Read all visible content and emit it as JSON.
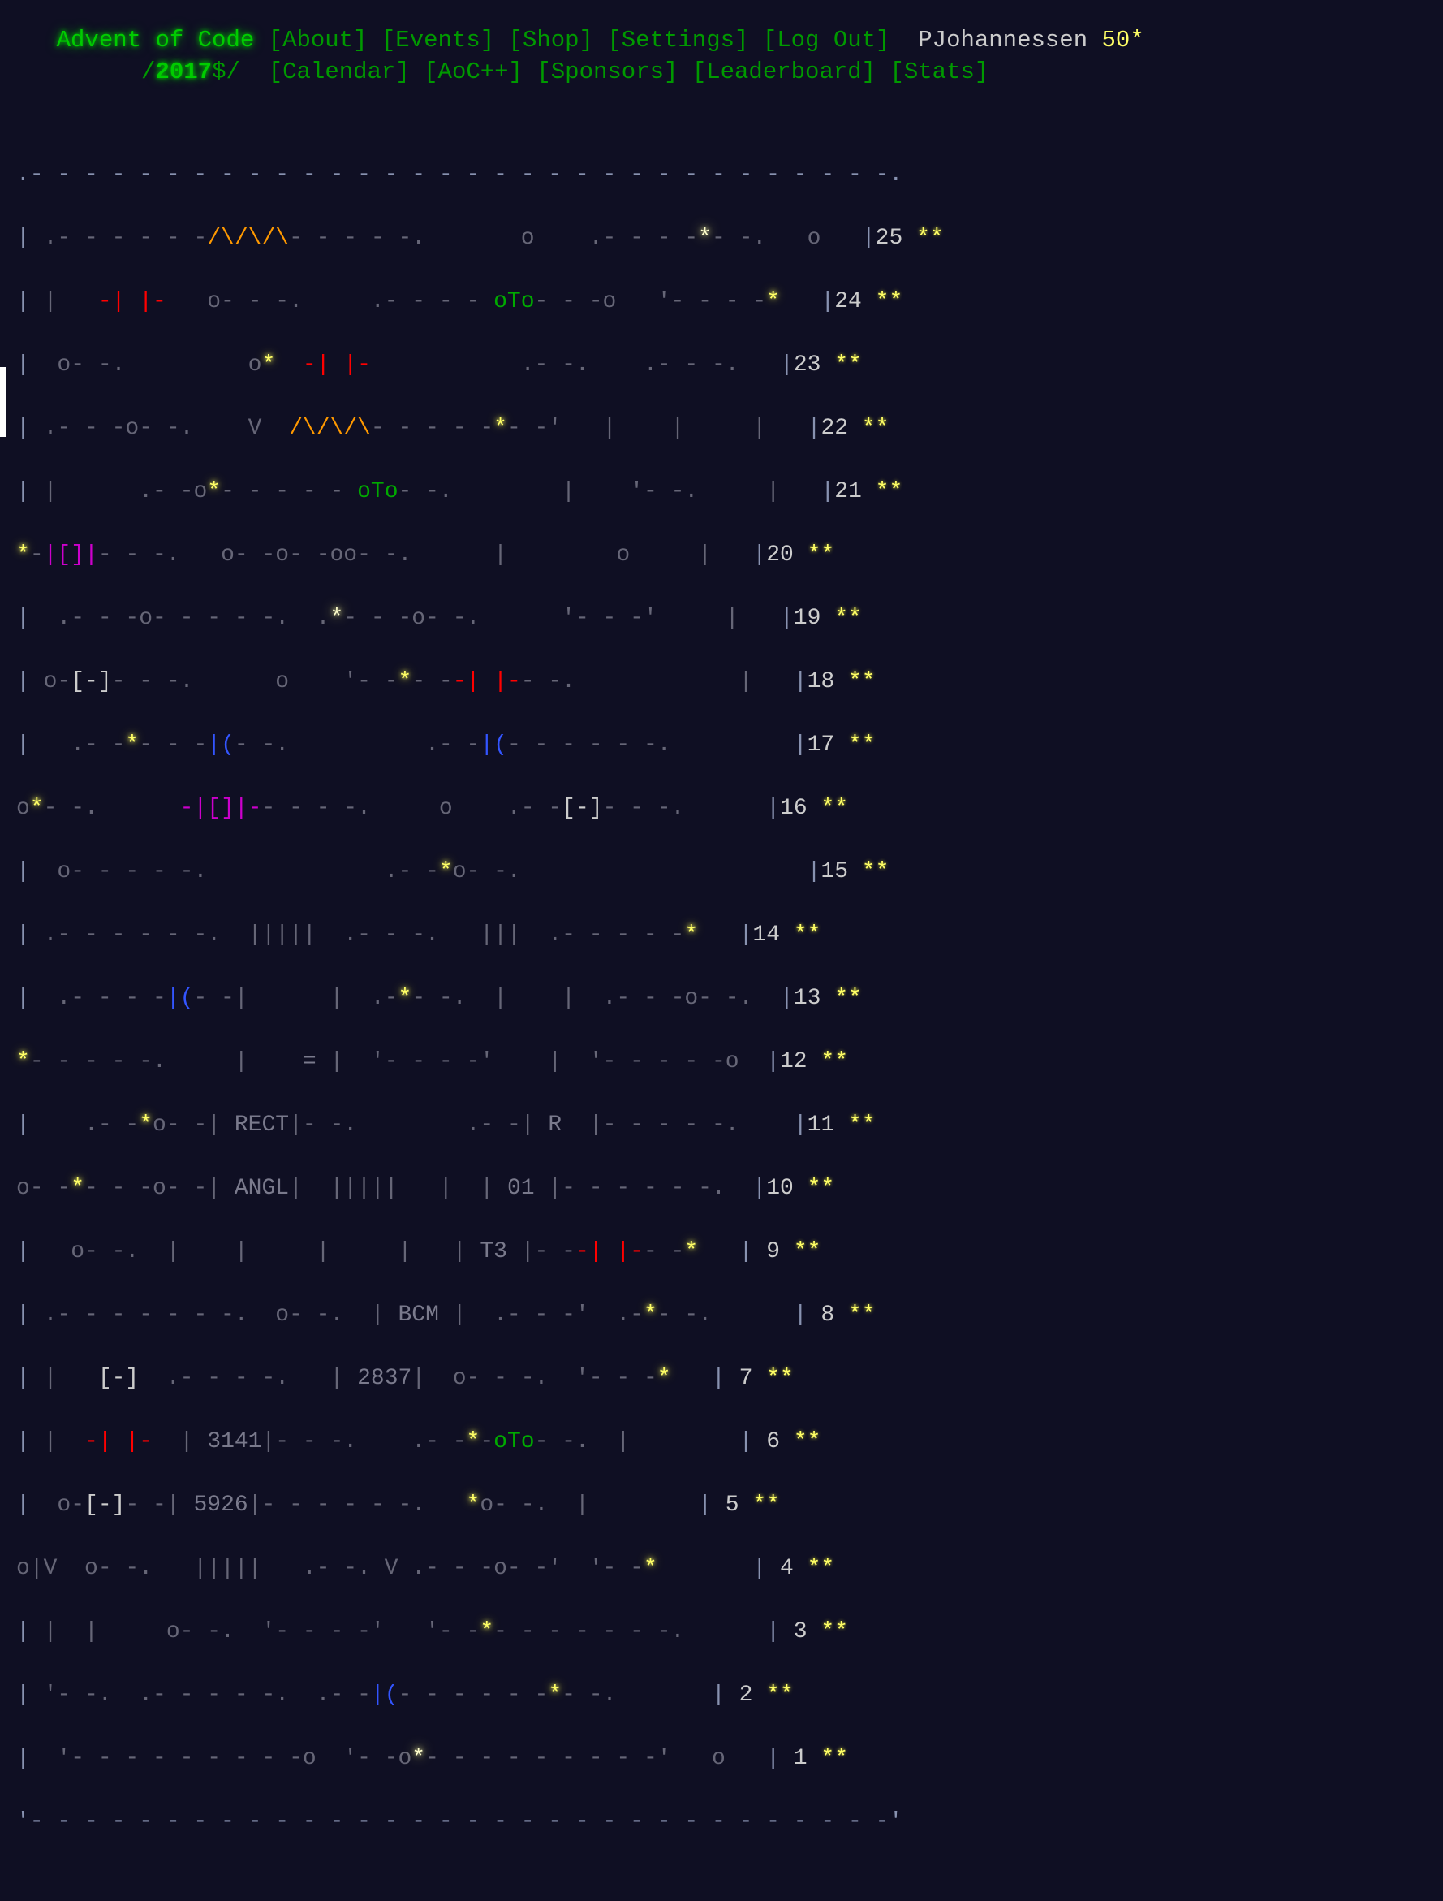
{
  "site": {
    "logo": "Advent of Code",
    "year_link": "/^2017$/",
    "year": "2017"
  },
  "header": {
    "top_nav": [
      {
        "label": "[About]",
        "name": "nav-about"
      },
      {
        "label": "[Events]",
        "name": "nav-events"
      },
      {
        "label": "[Shop]",
        "name": "nav-shop"
      },
      {
        "label": "[Settings]",
        "name": "nav-settings"
      },
      {
        "label": "[Log Out]",
        "name": "nav-log-out"
      }
    ],
    "bottom_nav": [
      {
        "label": "[Calendar]",
        "name": "nav-calendar"
      },
      {
        "label": "[AoC++]",
        "name": "nav-aocpp"
      },
      {
        "label": "[Sponsors]",
        "name": "nav-sponsors"
      },
      {
        "label": "[Leaderboard]",
        "name": "nav-leaderboard"
      },
      {
        "label": "[Stats]",
        "name": "nav-stats"
      }
    ],
    "user": {
      "name": "PJohannessen",
      "star_count": "50",
      "star_glyph": "*"
    }
  },
  "calendar": {
    "theme": "circuit-board",
    "chip_labels": [
      "RECT",
      "ANGL",
      "BCM",
      "2837",
      "3141",
      "5926",
      "R",
      "01",
      "T3"
    ],
    "component_glyphs": {
      "resistor": "/\\/\\/\\",
      "capacitor_red": "-| |-",
      "capacitor_magenta": "-|[]|-",
      "diode_blue": "|(",
      "transistor_green": "oTo",
      "fuse_white": "[-]",
      "node": "o",
      "star": "*"
    },
    "colors": {
      "background": "#0f0f23",
      "wire": "#666677",
      "chip_text": "#7a7a8c",
      "resistor": "#ff9900",
      "capacitor": "#ff0000",
      "transistor": "#00aa00",
      "diode": "#3355ff",
      "magenta_part": "#cc00cc",
      "star": "#ffff66",
      "border": "#8892b0"
    },
    "days": [
      {
        "day": "25",
        "stars": "**",
        "title": "Day 25"
      },
      {
        "day": "24",
        "stars": "**",
        "title": "Day 24"
      },
      {
        "day": "23",
        "stars": "**",
        "title": "Day 23"
      },
      {
        "day": "22",
        "stars": "**",
        "title": "Day 22"
      },
      {
        "day": "21",
        "stars": "**",
        "title": "Day 21"
      },
      {
        "day": "20",
        "stars": "**",
        "title": "Day 20"
      },
      {
        "day": "19",
        "stars": "**",
        "title": "Day 19"
      },
      {
        "day": "18",
        "stars": "**",
        "title": "Day 18"
      },
      {
        "day": "17",
        "stars": "**",
        "title": "Day 17"
      },
      {
        "day": "16",
        "stars": "**",
        "title": "Day 16"
      },
      {
        "day": "15",
        "stars": "**",
        "title": "Day 15"
      },
      {
        "day": "14",
        "stars": "**",
        "title": "Day 14"
      },
      {
        "day": "13",
        "stars": "**",
        "title": "Day 13"
      },
      {
        "day": "12",
        "stars": "**",
        "title": "Day 12"
      },
      {
        "day": "11",
        "stars": "**",
        "title": "Day 11"
      },
      {
        "day": "10",
        "stars": "**",
        "title": "Day 10"
      },
      {
        "day": "9",
        "stars": "**",
        "title": "Day 9"
      },
      {
        "day": "8",
        "stars": "**",
        "title": "Day 8"
      },
      {
        "day": "7",
        "stars": "**",
        "title": "Day 7"
      },
      {
        "day": "6",
        "stars": "**",
        "title": "Day 6"
      },
      {
        "day": "5",
        "stars": "**",
        "title": "Day 5"
      },
      {
        "day": "4",
        "stars": "**",
        "title": "Day 4"
      },
      {
        "day": "3",
        "stars": "**",
        "title": "Day 3"
      },
      {
        "day": "2",
        "stars": "**",
        "title": "Day 2"
      },
      {
        "day": "1",
        "stars": "**",
        "title": "Day 1"
      }
    ]
  },
  "art": {
    "rows": [
      ".--------------------------------------------------------.",
      "|    .-----/\\/\\/\\-----.     o   .----*---.   o            |",
      "| .-| |-.  o----------|-----oTo---o-'    '---*            |",
      "|  o--'  .--o*-| |-.  |  .---.  .---.                     |",
      "|  .--o--' V /\\/\\/\\---'--*--'   |   '--.                  |",
      "|  |   .-----o*------oTo--.     |      |                  |",
      "*-|[]|-.  o--o-oo--.      '--o--'   .--'                  |",
      "|   .--o---.  .*---o--.     .---.   |                     |",
      "| o-[-]-.  o  '--*-| |-.    |   '---'                     |",
      "|  .--*--|(--.    .--|(--.  |                             |",
      "o*-.  -|[]|-.  o--'    [-]--'                             |",
      "| o-------.  .*o--.  .---.                                |",
      "|  .---.  |  |  |  | | | |                  *             |",
      "|  |   |  | |( |  o  '---.     .--o--.                    |",
      "*--'   | = |  |  .--.     |    |     o                    |",
      "|  .*o-| RECT  |  |  '--. | R  '-----.                    |",
      "o-*--o-| ANGL |||||  |   | 01 .------'                    |",
      "|  .-o-'  ||||    .--'   | T3-| |-*                       |",
      "|  |   .-----o--. BCM .---*                               |",
      "| [-]  .--.     | 2837 | o---.  .--*                      |",
      "| -| |-| 3141 |-'   .--*-oTo-.  |                         |",
      "|  o-[-]| 5926 |----'     *o--. |                         |",
      "|o|V o--.    .---. V .----o--'--*                         |",
      "| |  |  '--o-'   '---.   *---.                            |",
      "'--------o----|(----o-*--o----------------o---------------'"
    ]
  }
}
